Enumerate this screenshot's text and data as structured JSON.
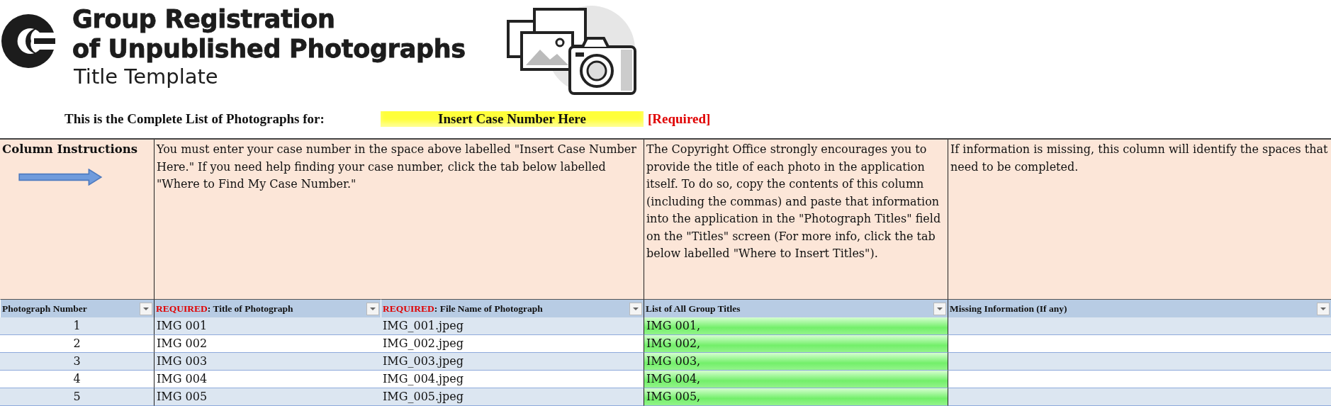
{
  "header": {
    "title_lines": [
      "Group Registration",
      "of Unpublished Photographs"
    ],
    "subtitle": "Title Template"
  },
  "case_line": {
    "label": "This is the Complete List of Photographs for:",
    "value": "Insert Case Number Here",
    "required_note": "[Required]"
  },
  "instructions": {
    "label": "Column Instructions",
    "texts": [
      "You must enter your case number in the space above labelled \"Insert Case Number Here.\" If you need help finding your case number, click the tab below labelled \"Where to Find My Case Number.\"",
      "The Copyright Office strongly encourages you to provide the title of each photo in the application itself. To do so, copy the contents of this column (including the commas) and paste that information into the application in the \"Photograph Titles\" field on the \"Titles\" screen (For more info, click the tab below labelled \"Where to Insert Titles\").",
      "If information is missing, this column will identify the spaces that need to be completed."
    ]
  },
  "columns": [
    {
      "label": "Photograph Number"
    },
    {
      "prefix": "REQUIRED",
      "label": ": Title of Photograph"
    },
    {
      "prefix": "REQUIRED",
      "label": ": File Name of Photograph"
    },
    {
      "label": "List of All Group Titles"
    },
    {
      "label": "Missing Information (If any)"
    }
  ],
  "rows": [
    {
      "number": "1",
      "title": "IMG 001",
      "file": "IMG_001.jpeg",
      "group_title": "IMG 001,"
    },
    {
      "number": "2",
      "title": "IMG 002",
      "file": "IMG_002.jpeg",
      "group_title": "IMG 002,"
    },
    {
      "number": "3",
      "title": "IMG 003",
      "file": "IMG_003.jpeg",
      "group_title": "IMG 003,"
    },
    {
      "number": "4",
      "title": "IMG 004",
      "file": "IMG_004.jpeg",
      "group_title": "IMG 004,"
    },
    {
      "number": "5",
      "title": "IMG 005",
      "file": "IMG_005.jpeg",
      "group_title": "IMG 005,"
    }
  ]
}
